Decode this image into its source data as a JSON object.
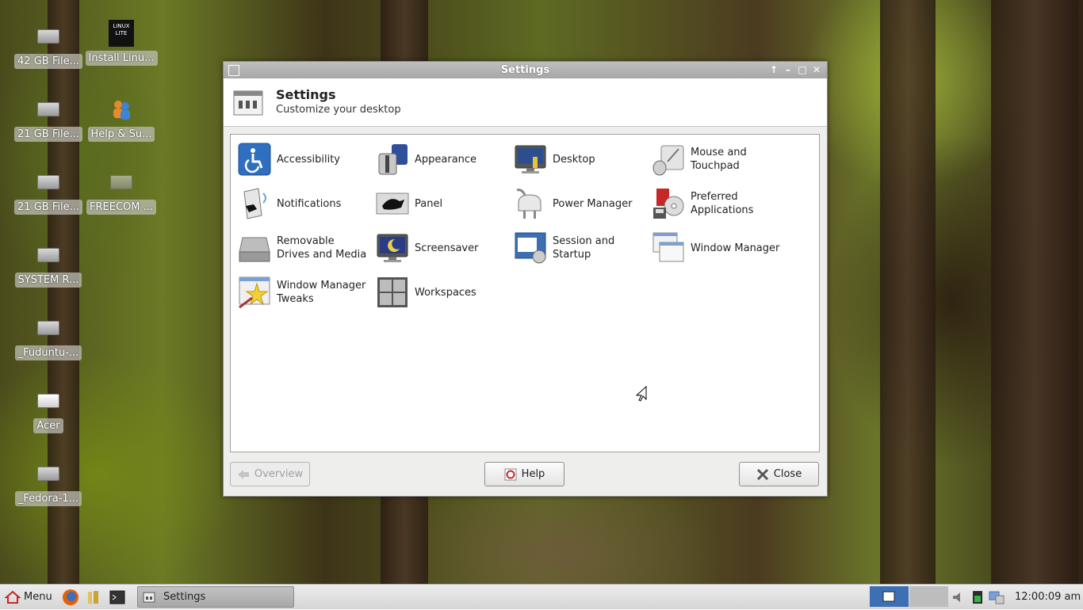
{
  "desktop_icons": [
    {
      "label": "42 GB File...",
      "icon": "drive-icon"
    },
    {
      "label": "Install Linu...",
      "icon": "linux-lite-icon"
    },
    {
      "label": "21 GB File...",
      "icon": "drive-icon"
    },
    {
      "label": "Help & Su...",
      "icon": "help-support-icon"
    },
    {
      "label": "21 GB File...",
      "icon": "drive-icon"
    },
    {
      "label": "FREECOM ...",
      "icon": "drive-icon"
    },
    {
      "label": "SYSTEM R...",
      "icon": "drive-icon"
    },
    {
      "label": "_Fuduntu-...",
      "icon": "drive-icon"
    },
    {
      "label": "Acer",
      "icon": "drive-icon"
    },
    {
      "label": "_Fedora-1...",
      "icon": "drive-icon"
    }
  ],
  "linux_lite_badge": "LINUX LITE",
  "window": {
    "title": "Settings",
    "header_title": "Settings",
    "header_subtitle": "Customize your desktop"
  },
  "items": [
    {
      "label": "Accessibility",
      "icon": "accessibility-icon"
    },
    {
      "label": "Appearance",
      "icon": "appearance-icon"
    },
    {
      "label": "Desktop",
      "icon": "desktop-icon"
    },
    {
      "label": "Mouse and Touchpad",
      "icon": "mouse-icon"
    },
    {
      "label": "Notifications",
      "icon": "notifications-icon"
    },
    {
      "label": "Panel",
      "icon": "panel-icon"
    },
    {
      "label": "Power Manager",
      "icon": "power-plug-icon"
    },
    {
      "label": "Preferred Applications",
      "icon": "preferred-apps-icon"
    },
    {
      "label": "Removable Drives and Media",
      "icon": "removable-drive-icon"
    },
    {
      "label": "Screensaver",
      "icon": "screensaver-icon"
    },
    {
      "label": "Session and Startup",
      "icon": "session-icon"
    },
    {
      "label": "Window Manager",
      "icon": "window-manager-icon"
    },
    {
      "label": "Window Manager Tweaks",
      "icon": "wm-tweaks-icon"
    },
    {
      "label": "Workspaces",
      "icon": "workspaces-icon"
    }
  ],
  "buttons": {
    "overview": "Overview",
    "help": "Help",
    "close": "Close"
  },
  "taskbar": {
    "menu_label": "Menu",
    "task_label": "Settings",
    "clock": "12:00:09 am"
  },
  "colors": {
    "accent": "#3c6fb4",
    "titlebar": "#b4b4b4",
    "close_red": "#c62828"
  }
}
